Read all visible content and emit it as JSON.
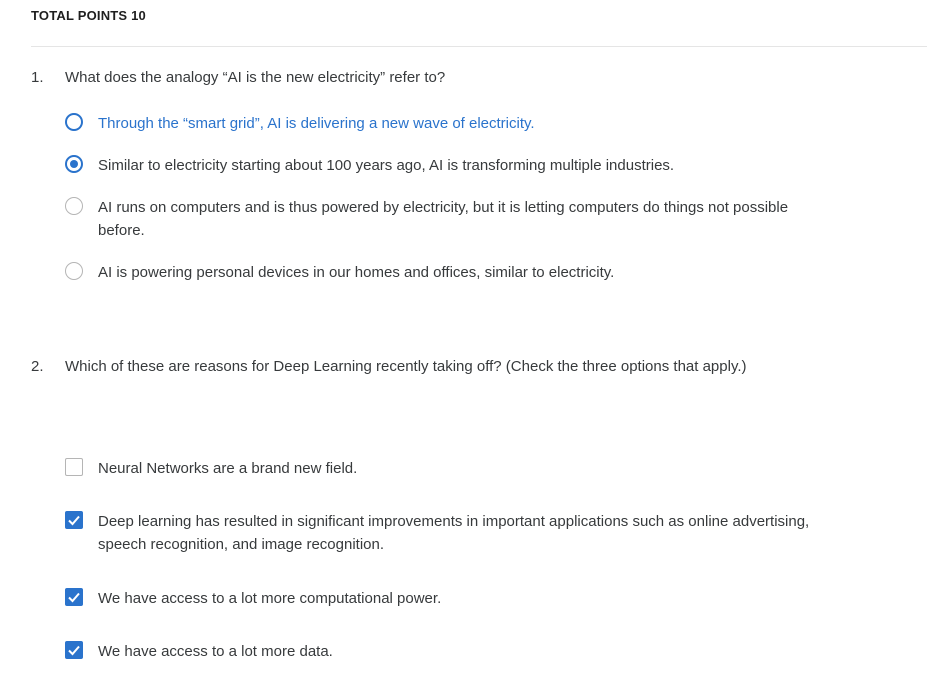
{
  "header": {
    "total_points": "TOTAL POINTS 10"
  },
  "questions": [
    {
      "number": "1.",
      "text": "What does the analogy “AI is the new electricity” refer to?",
      "type": "radio",
      "options": [
        {
          "label": "Through the “smart grid”, AI is delivering a new wave of electricity.",
          "checked": false,
          "highlighted": true
        },
        {
          "label": "Similar to electricity starting about 100 years ago, AI is transforming multiple industries.",
          "checked": true,
          "highlighted": false
        },
        {
          "label": "AI runs on computers and is thus powered by electricity, but it is letting computers do things not possible before.",
          "checked": false,
          "highlighted": false
        },
        {
          "label": "AI is powering personal devices in our homes and offices, similar to electricity.",
          "checked": false,
          "highlighted": false
        }
      ]
    },
    {
      "number": "2.",
      "text": "Which of these are reasons for Deep Learning recently taking off? (Check the three options that apply.)",
      "type": "checkbox",
      "options": [
        {
          "label": "Neural Networks are a brand new field.",
          "checked": false
        },
        {
          "label": "Deep learning has resulted in significant improvements in important applications such as online advertising, speech recognition, and image recognition.",
          "checked": true
        },
        {
          "label": "We have access to a lot more computational power.",
          "checked": true
        },
        {
          "label": "We have access to a lot more data.",
          "checked": true
        }
      ]
    }
  ],
  "colors": {
    "accent": "#2a73cc",
    "text": "#373a3c",
    "border": "#b5b5b5"
  },
  "icons": {
    "radio": "radio-button-icon",
    "checkbox": "checkbox-icon",
    "checkmark": "checkmark-icon"
  }
}
